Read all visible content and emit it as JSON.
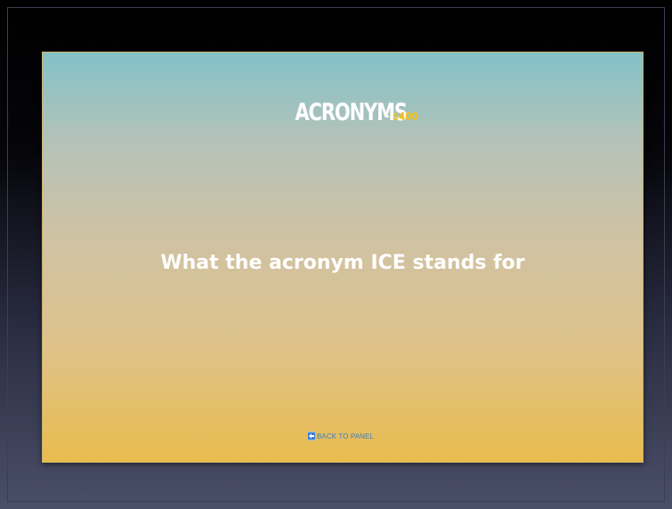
{
  "slide": {
    "category": "ACRONYMS",
    "separator": "-",
    "amount": "$400",
    "question": "What the acronym ICE stands for",
    "back_link": {
      "label": "BACK TO PANEL",
      "icon": "back-arrow-icon"
    }
  },
  "colors": {
    "slide_top": "#83c1c8",
    "slide_bottom": "#e9bc4e",
    "amount": "#f2c21c",
    "link": "#3d7fc4",
    "backdrop_top": "#000000",
    "backdrop_bottom": "#4a4f68"
  }
}
